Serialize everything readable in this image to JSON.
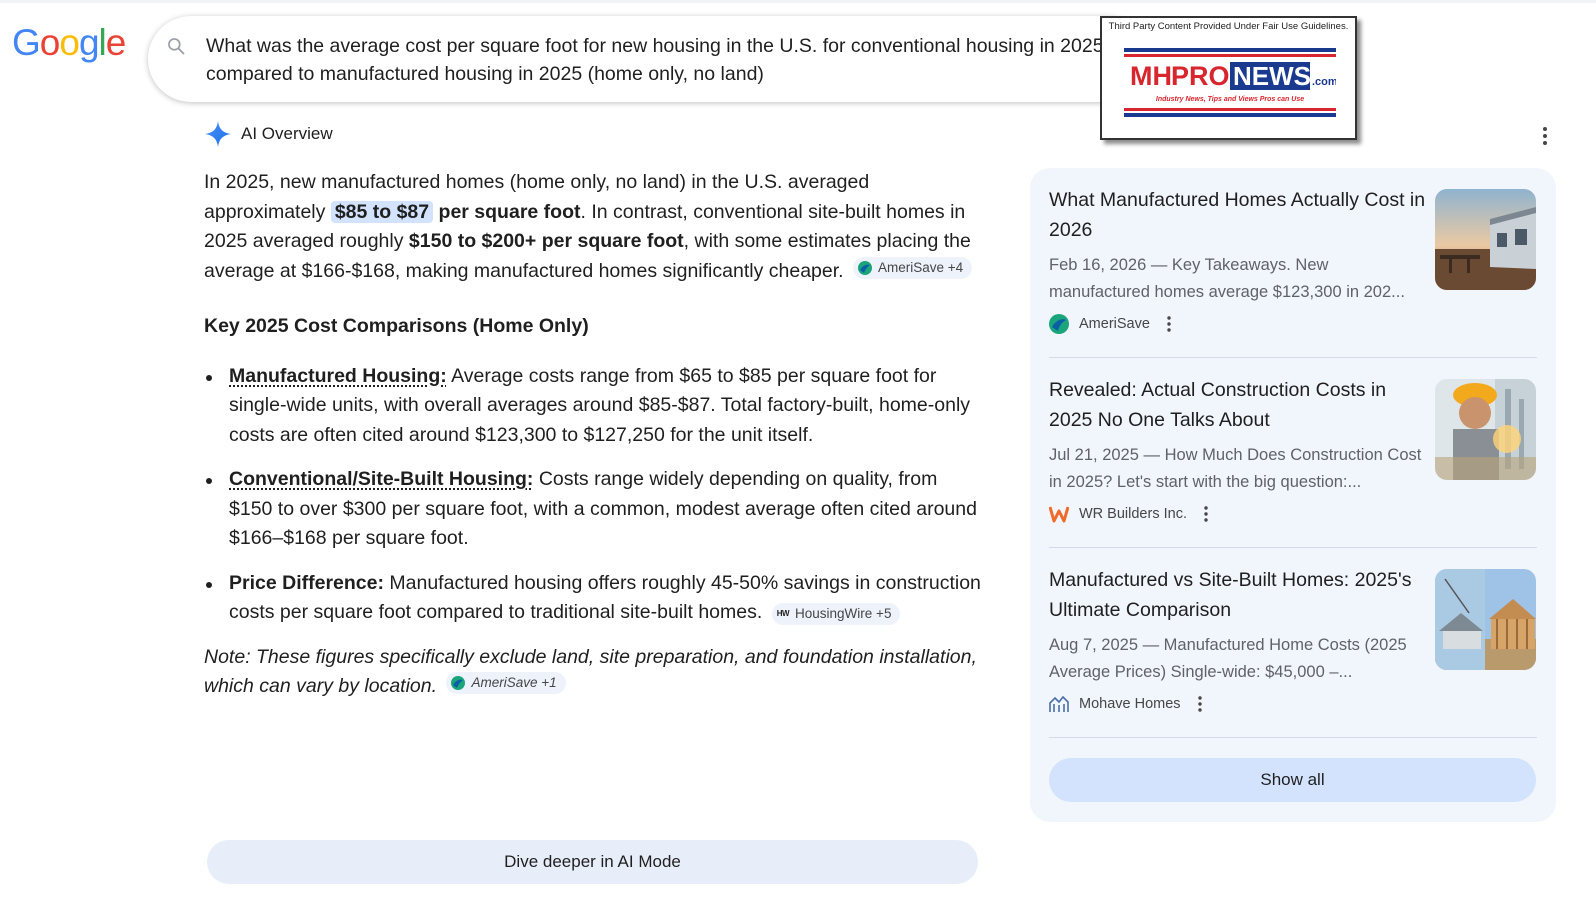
{
  "logo": {
    "letters": [
      "G",
      "o",
      "o",
      "g",
      "l",
      "e"
    ],
    "colors": [
      "#4285F4",
      "#EA4335",
      "#FBBC05",
      "#4285F4",
      "#34A853",
      "#EA4335"
    ]
  },
  "search": {
    "query": "What was the average cost per square foot for new housing in the U.S. for conventional housing in 2025 compared to manufactured housing in 2025 (home only, no land)",
    "icon": "search-icon"
  },
  "watermark": {
    "caption": "Third Party Content Provided Under Fair Use Guidelines.",
    "brand_mh": "MH",
    "brand_pro": "PRO",
    "brand_news": "NEWS",
    "brand_com": ".com",
    "tagline": "Industry News, Tips and Views Pros can Use"
  },
  "ai_overview": {
    "title": "AI Overview",
    "intro_1": "In 2025, new manufactured homes (home only, no land) in the U.S. averaged approximately ",
    "intro_hl": "$85 to $87",
    "intro_b1": " per square foot",
    "intro_2": ". In contrast, conventional site-built homes in 2025 averaged roughly ",
    "intro_b2": "$150 to $200+ per square foot",
    "intro_3": ", with some estimates placing the average at $166-$168, making manufactured homes significantly cheaper.",
    "intro_chip": "AmeriSave +4",
    "heading": "Key 2025 Cost Comparisons (Home Only)",
    "bullets": [
      {
        "term": "Manufactured Housing:",
        "text": " Average costs range from $65 to $85 per square foot for single-wide units, with overall averages around $85-$87. Total factory-built, home-only costs are often cited around $123,300 to $127,250 for the unit itself."
      },
      {
        "term": "Conventional/Site-Built Housing:",
        "text": " Costs range widely depending on quality, from $150 to over $300 per square foot, with a common, modest average often cited around $166–$168 per square foot."
      },
      {
        "term": "Price Difference:",
        "text": " Manufactured housing offers roughly 45-50% savings in construction costs per square foot compared to traditional site-built homes.",
        "chip": "HousingWire +5",
        "chip_logo": "HW"
      }
    ],
    "note": "Note: These figures specifically exclude land, site preparation, and foundation installation, which can vary by location.",
    "note_chip": "AmeriSave +1",
    "dive_button": "Dive deeper in AI Mode"
  },
  "sources": {
    "cards": [
      {
        "title": "What Manufactured Homes Actually Cost in 2026",
        "snippet": "Feb 16, 2026 — Key Takeaways. New manufactured homes average $123,300 in 202...",
        "source": "AmeriSave"
      },
      {
        "title": "Revealed: Actual Construction Costs in 2025 No One Talks About",
        "snippet": "Jul 21, 2025 — How Much Does Construction Cost in 2025? Let's start with the big question:...",
        "source": "WR Builders Inc."
      },
      {
        "title": "Manufactured vs Site-Built Homes: 2025's Ultimate Comparison",
        "snippet": "Aug 7, 2025 — Manufactured Home Costs (2025 Average Prices) Single-wide: $45,000 –...",
        "source": "Mohave Homes"
      }
    ],
    "show_all": "Show all"
  }
}
